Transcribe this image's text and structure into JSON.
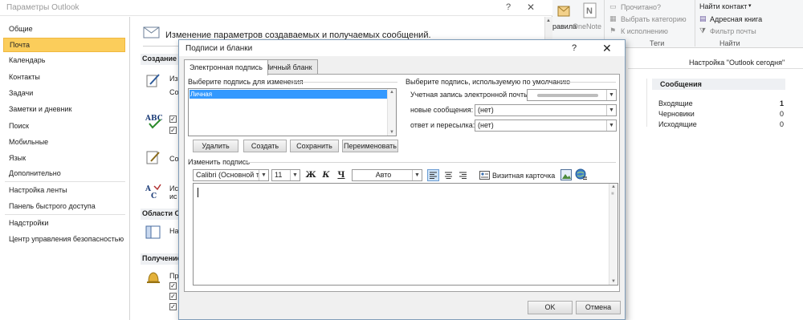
{
  "options_window": {
    "title": "Параметры Outlook",
    "help": "?",
    "close": "✕",
    "nav": [
      "Общие",
      "Почта",
      "Календарь",
      "Контакты",
      "Задачи",
      "Заметки и дневник",
      "Поиск",
      "Мобильные",
      "Язык",
      "Дополнительно",
      "Настройка ленты",
      "Панель быстрого доступа",
      "Надстройки",
      "Центр управления безопасностью"
    ],
    "active_nav": "Почта",
    "header_text": "Изменение параметров создаваемых и получаемых сообщений.",
    "sections": {
      "compose": "Создание с",
      "outlook_panes": "Области Outl",
      "receive": "Получение"
    },
    "fragments": {
      "edit_prefix": "Из",
      "edit_suffix": "Со",
      "abc_prefix": "Ис",
      "abc_suffix": "ис",
      "sig_prefix": "Со",
      "pane_prefix": "На",
      "recv_prefix": "Пр"
    }
  },
  "ribbon": {
    "pravila": "равила",
    "onenote": "OneNote",
    "read": "Прочитано?",
    "choose_category": "Выбрать категорию",
    "followup": "К исполнению",
    "tags": "Теги",
    "find_contact": "Найти контакт",
    "address_book": "Адресная книга",
    "filter_mail": "Фильтр почты",
    "find": "Найти",
    "outlook_today": "Настройка \"Outlook сегодня\""
  },
  "messages_panel": {
    "title": "Сообщения",
    "rows": [
      {
        "label": "Входящие",
        "count": "1"
      },
      {
        "label": "Черновики",
        "count": "0"
      },
      {
        "label": "Исходящие",
        "count": "0"
      }
    ]
  },
  "dialog": {
    "title": "Подписи и бланки",
    "help": "?",
    "close": "✕",
    "tabs": [
      "Электронная подпись",
      "Личный бланк"
    ],
    "select_sig_label": "Выберите подпись для изменения",
    "signatures": [
      "Личная"
    ],
    "buttons": {
      "delete": "Удалить",
      "create": "Создать",
      "save": "Сохранить",
      "rename": "Переименовать"
    },
    "default_sig_group": "Выберите подпись, используемую по умолчанию",
    "email_account_label": "Учетная запись электронной почты:",
    "new_messages_label": "новые сообщения:",
    "new_messages_value": "(нет)",
    "replies_label": "ответ и пересылка:",
    "replies_value": "(нет)",
    "edit_sig_label": "Изменить подпись",
    "font_value": "Calibri (Основной тек",
    "size_value": "11",
    "bold": "Ж",
    "italic": "К",
    "underline": "Ч",
    "color_value": "Авто",
    "business_card": "Визитная карточка",
    "ok": "OK",
    "cancel": "Отмена"
  }
}
